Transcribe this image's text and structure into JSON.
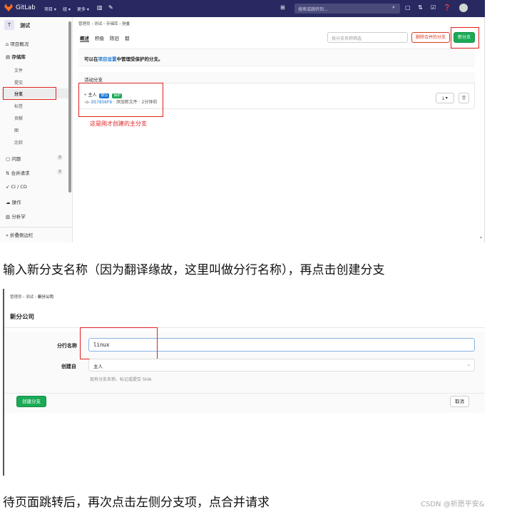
{
  "shot1": {
    "topbar": {
      "brand": "GitLab",
      "menu1": "项目 ▾",
      "menu2": "组 ▾",
      "menu3": "更多 ▾",
      "search_placeholder": "搜索或跳转到…"
    },
    "sidebar": {
      "project_initial": "T",
      "project_name": "测试",
      "items": [
        {
          "label": "项目概况"
        },
        {
          "label": "存储库"
        },
        {
          "label": "文件"
        },
        {
          "label": "提交"
        },
        {
          "label": "分支"
        },
        {
          "label": "标签"
        },
        {
          "label": "贡献"
        },
        {
          "label": "图"
        },
        {
          "label": "比较"
        },
        {
          "label": "问题",
          "count": "0"
        },
        {
          "label": "合并请求",
          "count": "0"
        },
        {
          "label": "CI / CD"
        },
        {
          "label": "操作"
        },
        {
          "label": "分析学"
        },
        {
          "label": "折叠侧边栏"
        }
      ]
    },
    "breadcrumb": [
      "管理员",
      "测试",
      "存储库",
      "分支"
    ],
    "tabs": [
      "概述",
      "积极",
      "陈旧",
      "都"
    ],
    "filter_placeholder": "按分支名称筛选",
    "delete_merged_label": "删除合并的分支",
    "new_branch_label": "新分支",
    "info_prefix": "可以在",
    "info_link": "项目设置",
    "info_suffix": "中管理受保护的分支。",
    "active_header": "活动分支",
    "branch_name": "主人",
    "tag_default": "默认",
    "tag_protected": "保护",
    "commit_sha": "D57856F6",
    "commit_msg": "· 添加新文件 · 2分钟前",
    "annotation": "这是刚才创建的主分支"
  },
  "caption1": "输入新分支名称（因为翻译缘故，这里叫做分行名称），再点击创建分支",
  "shot2": {
    "breadcrumb": [
      "管理员",
      "测试",
      "新分公司"
    ],
    "title": "新分公司",
    "branch_label": "分行名称",
    "branch_value": "linux",
    "from_label": "创建自",
    "from_value": "主人",
    "hint": "现有分支名称、标记或提交 SHA",
    "create_label": "创建分支",
    "cancel_label": "取消"
  },
  "caption2": "待页面跳转后，再次点击左侧分支项，点合并请求",
  "watermark": "CSDN @祈愿平安&",
  "colors": {
    "topbar": "#292961",
    "green": "#1aaa55",
    "red": "#e02020",
    "blue": "#1f78d1"
  }
}
